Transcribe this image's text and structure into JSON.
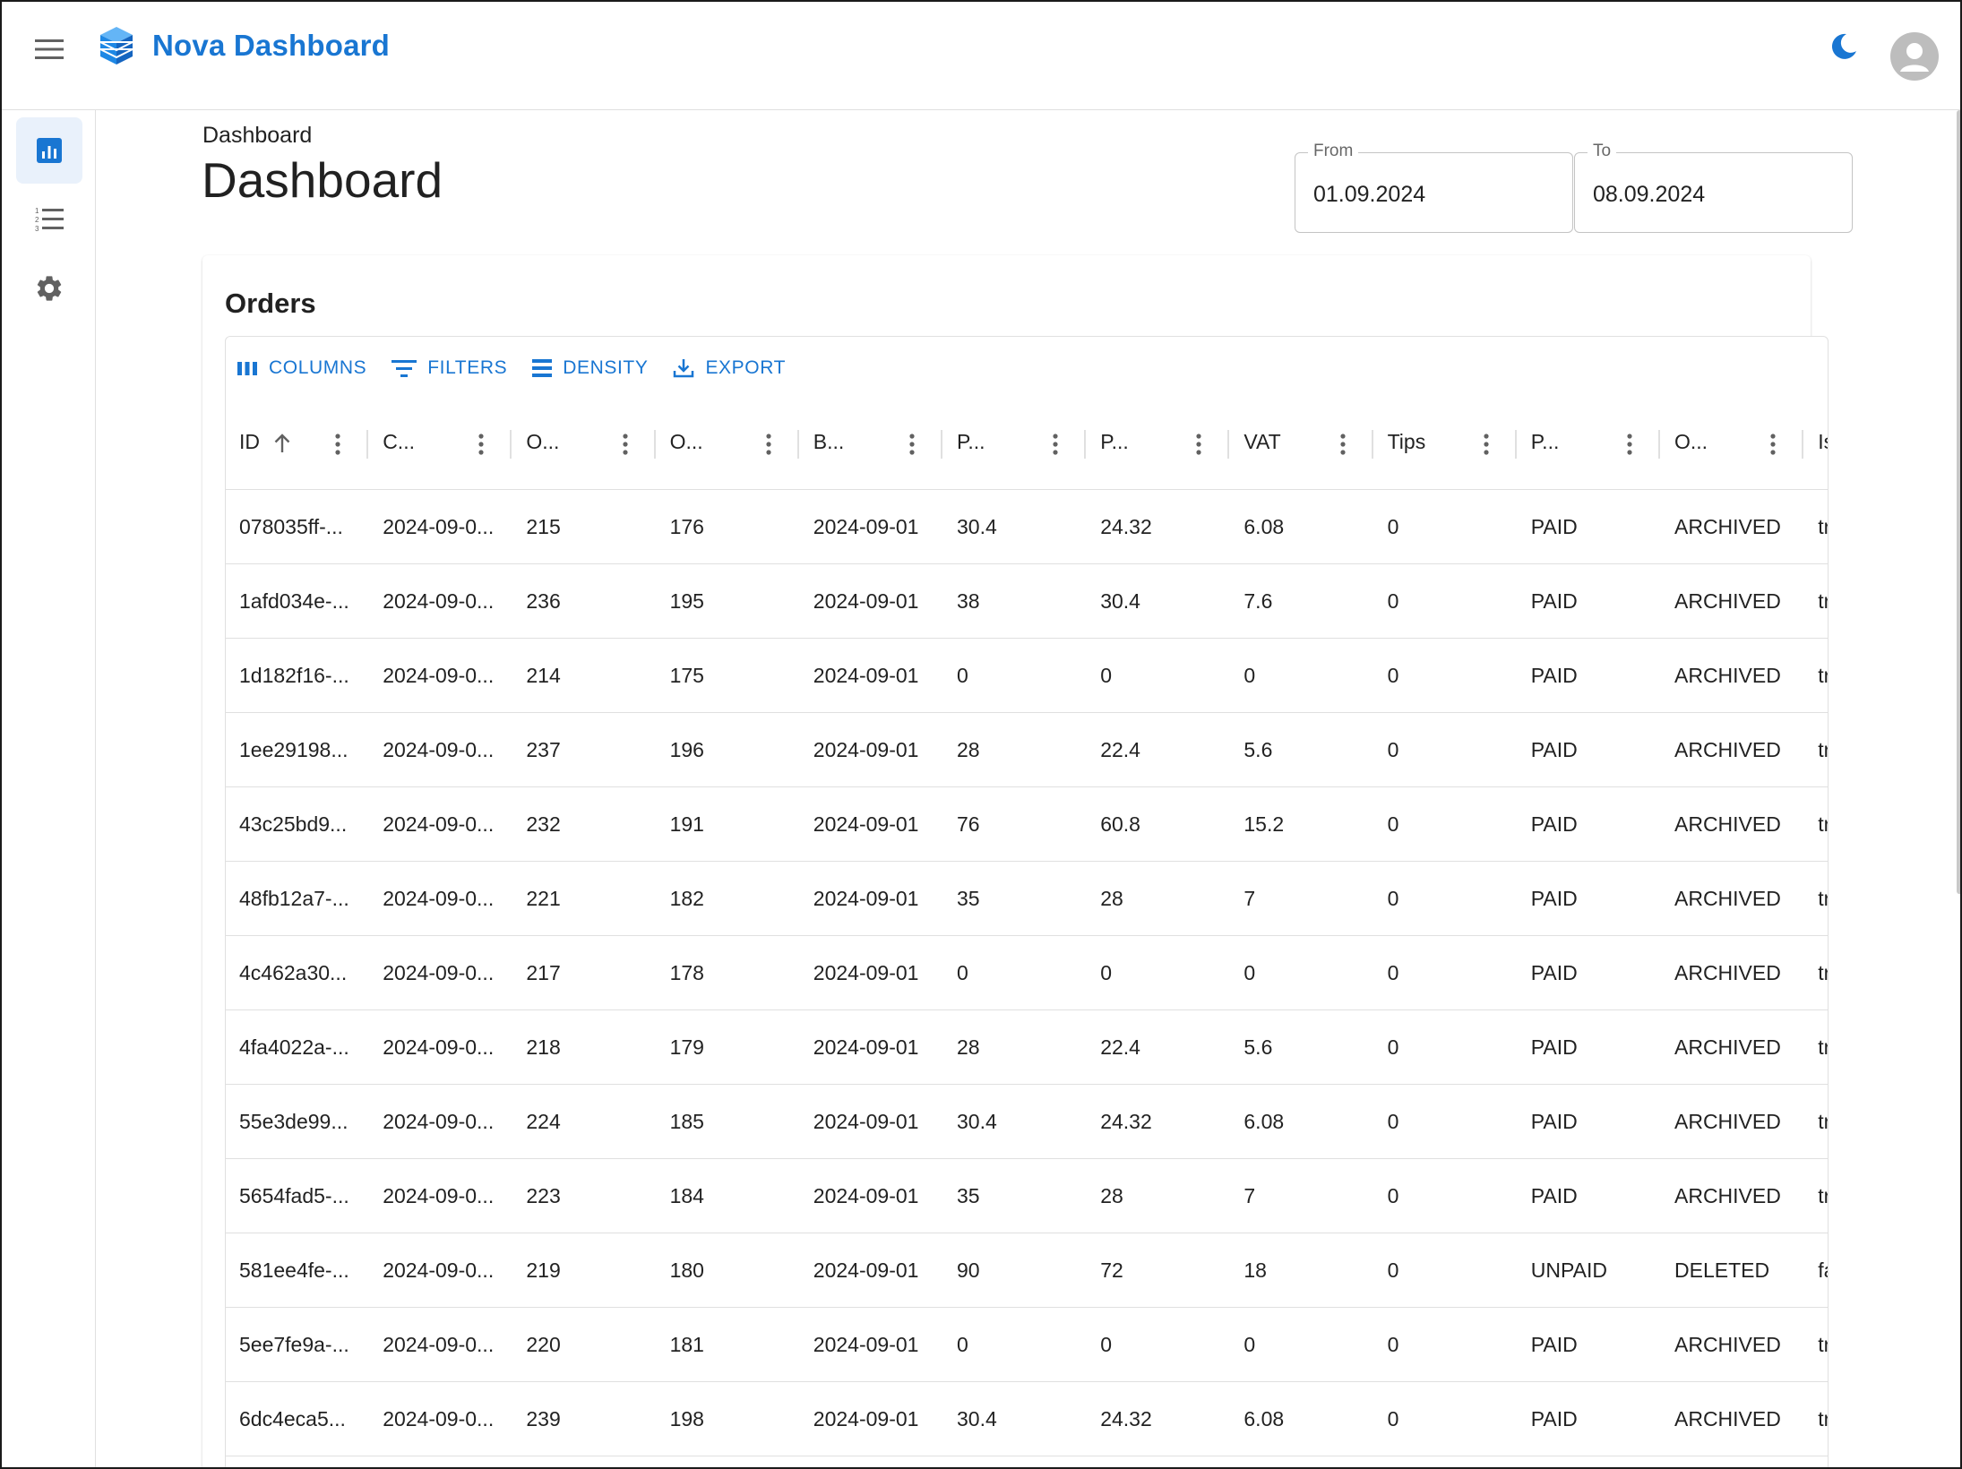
{
  "app": {
    "brand": "Nova Dashboard",
    "accent": "#1976d2",
    "icons": {
      "menu": "hamburger-icon",
      "logo": "cube-logo",
      "theme": "moon-icon",
      "avatar": "user-avatar-icon"
    }
  },
  "sidebar": {
    "items": [
      {
        "name": "dashboard",
        "icon": "bar-chart-icon",
        "active": true
      },
      {
        "name": "list",
        "icon": "numbered-list-icon",
        "active": false
      },
      {
        "name": "settings",
        "icon": "gear-icon",
        "active": false
      }
    ]
  },
  "page": {
    "breadcrumb": "Dashboard",
    "title": "Dashboard",
    "from": {
      "label": "From",
      "value": "01.09.2024"
    },
    "to": {
      "label": "To",
      "value": "08.09.2024"
    }
  },
  "orders": {
    "title": "Orders",
    "toolbar": {
      "columns": "COLUMNS",
      "filters": "FILTERS",
      "density": "DENSITY",
      "export": "EXPORT"
    },
    "headers": [
      "ID",
      "C...",
      "O...",
      "O...",
      "B...",
      "P...",
      "P...",
      "VAT",
      "Tips",
      "P...",
      "O...",
      "Is"
    ],
    "sort": {
      "column": "ID",
      "direction": "ascending"
    },
    "rows": [
      [
        "078035ff-...",
        "2024-09-0...",
        "215",
        "176",
        "2024-09-01",
        "30.4",
        "24.32",
        "6.08",
        "0",
        "PAID",
        "ARCHIVED",
        "tr"
      ],
      [
        "1afd034e-...",
        "2024-09-0...",
        "236",
        "195",
        "2024-09-01",
        "38",
        "30.4",
        "7.6",
        "0",
        "PAID",
        "ARCHIVED",
        "tr"
      ],
      [
        "1d182f16-...",
        "2024-09-0...",
        "214",
        "175",
        "2024-09-01",
        "0",
        "0",
        "0",
        "0",
        "PAID",
        "ARCHIVED",
        "tr"
      ],
      [
        "1ee29198...",
        "2024-09-0...",
        "237",
        "196",
        "2024-09-01",
        "28",
        "22.4",
        "5.6",
        "0",
        "PAID",
        "ARCHIVED",
        "tr"
      ],
      [
        "43c25bd9...",
        "2024-09-0...",
        "232",
        "191",
        "2024-09-01",
        "76",
        "60.8",
        "15.2",
        "0",
        "PAID",
        "ARCHIVED",
        "tr"
      ],
      [
        "48fb12a7-...",
        "2024-09-0...",
        "221",
        "182",
        "2024-09-01",
        "35",
        "28",
        "7",
        "0",
        "PAID",
        "ARCHIVED",
        "tr"
      ],
      [
        "4c462a30...",
        "2024-09-0...",
        "217",
        "178",
        "2024-09-01",
        "0",
        "0",
        "0",
        "0",
        "PAID",
        "ARCHIVED",
        "tr"
      ],
      [
        "4fa4022a-...",
        "2024-09-0...",
        "218",
        "179",
        "2024-09-01",
        "28",
        "22.4",
        "5.6",
        "0",
        "PAID",
        "ARCHIVED",
        "tr"
      ],
      [
        "55e3de99...",
        "2024-09-0...",
        "224",
        "185",
        "2024-09-01",
        "30.4",
        "24.32",
        "6.08",
        "0",
        "PAID",
        "ARCHIVED",
        "tr"
      ],
      [
        "5654fad5-...",
        "2024-09-0...",
        "223",
        "184",
        "2024-09-01",
        "35",
        "28",
        "7",
        "0",
        "PAID",
        "ARCHIVED",
        "tr"
      ],
      [
        "581ee4fe-...",
        "2024-09-0...",
        "219",
        "180",
        "2024-09-01",
        "90",
        "72",
        "18",
        "0",
        "UNPAID",
        "DELETED",
        "fa"
      ],
      [
        "5ee7fe9a-...",
        "2024-09-0...",
        "220",
        "181",
        "2024-09-01",
        "0",
        "0",
        "0",
        "0",
        "PAID",
        "ARCHIVED",
        "tr"
      ],
      [
        "6dc4eca5...",
        "2024-09-0...",
        "239",
        "198",
        "2024-09-01",
        "30.4",
        "24.32",
        "6.08",
        "0",
        "PAID",
        "ARCHIVED",
        "tr"
      ]
    ]
  }
}
